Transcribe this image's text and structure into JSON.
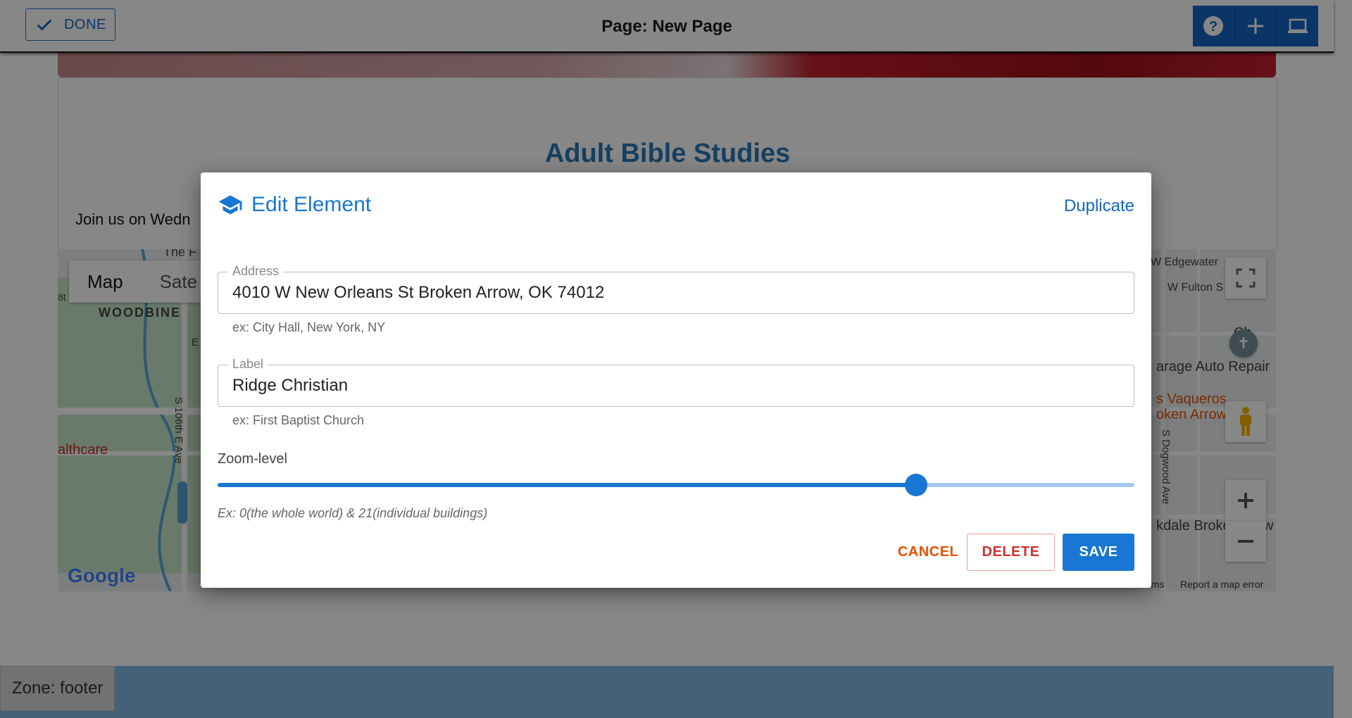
{
  "topbar": {
    "done_label": "DONE",
    "page_title": "Page: New Page",
    "tools": [
      "help-icon",
      "add-icon",
      "laptop-icon"
    ]
  },
  "page": {
    "card_heading": "Adult Bible Studies",
    "card_text": "Join us on Wedn",
    "map": {
      "tabs": [
        "Map",
        "Sate"
      ],
      "labels": {
        "woodbine": "WOODBINE",
        "top_left": "The F",
        "left_edge": "8t",
        "street_vertical": "S 106th E Ave",
        "letter_e": "E",
        "healthcare": "althcare",
        "edgewater": "W Edgewater",
        "fulton": "W Fulton S",
        "church_partial": "Ch",
        "auto_repair": "arage Auto Repair",
        "vaqueros": "s Vaqueros",
        "broken_arrow": "oken Arrow",
        "dogwood": "S Dogwood Ave",
        "oakdale": "kdale Broke",
        "w_edge": "w",
        "terms": "rms",
        "report": "Report a map error"
      },
      "google": "Google"
    },
    "footer_zone": "Zone: footer"
  },
  "dialog": {
    "title": "Edit Element",
    "title_icon": "graduation-cap-icon",
    "duplicate_label": "Duplicate",
    "address": {
      "label": "Address",
      "value": "4010 W New Orleans St Broken Arrow, OK 74012",
      "hint": "ex: City Hall, New York, NY"
    },
    "label_field": {
      "label": "Label",
      "value": "Ridge Christian",
      "hint": "ex: First Baptist Church"
    },
    "zoom": {
      "label": "Zoom-level",
      "value": 16,
      "min": 0,
      "max": 21,
      "hint": "Ex: 0(the whole world) & 21(individual buildings)"
    },
    "buttons": {
      "cancel": "CANCEL",
      "delete": "DELETE",
      "save": "SAVE"
    }
  },
  "colors": {
    "primary": "#1976d2",
    "cancel": "#e65100",
    "delete": "#d32f2f",
    "heading": "#2b78b8"
  }
}
